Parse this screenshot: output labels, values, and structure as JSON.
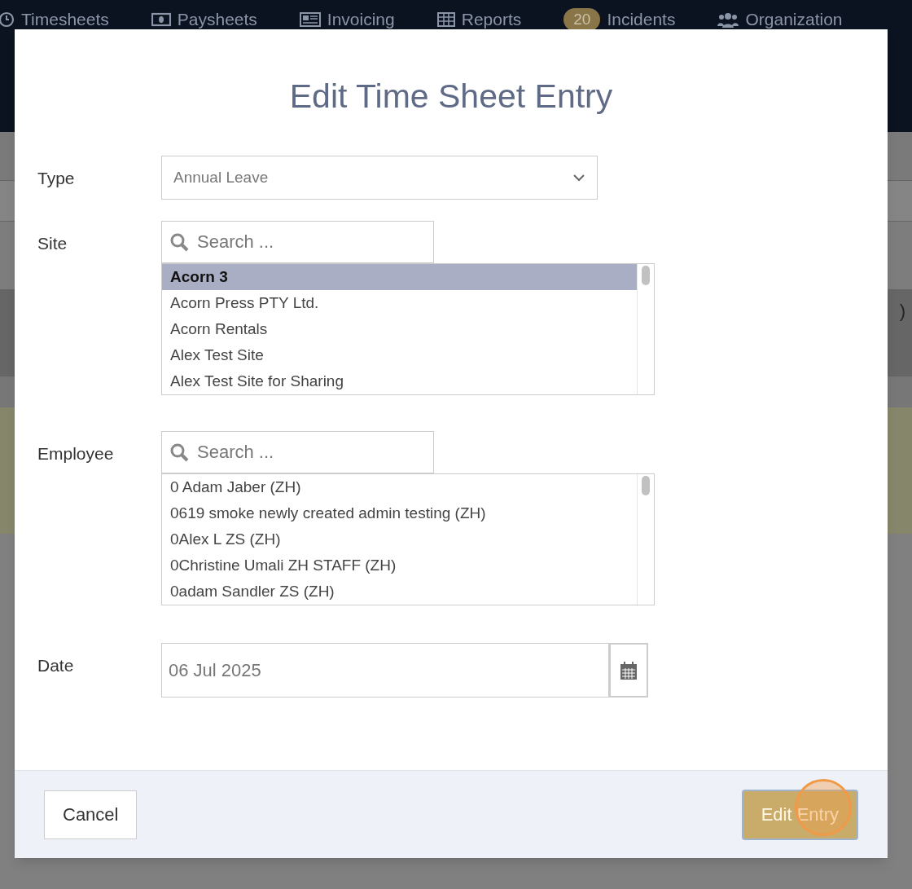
{
  "nav": [
    {
      "label": "Timesheets"
    },
    {
      "label": "Paysheets"
    },
    {
      "label": "Invoicing"
    },
    {
      "label": "Reports"
    },
    {
      "badge": "20",
      "label": "Incidents"
    },
    {
      "label": "Organization"
    }
  ],
  "background_fragment": ")",
  "dialog": {
    "title": "Edit Time Sheet Entry",
    "type": {
      "label": "Type",
      "value": "Annual Leave"
    },
    "site": {
      "label": "Site",
      "placeholder": "Search ...",
      "options": [
        {
          "label": "Acorn 3",
          "selected": true
        },
        {
          "label": "Acorn Press PTY Ltd.",
          "selected": false
        },
        {
          "label": "Acorn Rentals",
          "selected": false
        },
        {
          "label": "Alex Test Site",
          "selected": false
        },
        {
          "label": "Alex Test Site for Sharing",
          "selected": false
        }
      ]
    },
    "employee": {
      "label": "Employee",
      "placeholder": "Search ...",
      "options": [
        {
          "label": "0 Adam Jaber (ZH)",
          "selected": false
        },
        {
          "label": "0619 smoke newly created admin testing (ZH)",
          "selected": false
        },
        {
          "label": "0Alex L ZS (ZH)",
          "selected": false
        },
        {
          "label": "0Christine Umali ZH STAFF (ZH)",
          "selected": false
        },
        {
          "label": "0adam Sandler ZS (ZH)",
          "selected": false
        }
      ]
    },
    "date": {
      "label": "Date",
      "value": "06 Jul 2025"
    },
    "buttons": [
      {
        "kind": "secondary",
        "label": "Cancel"
      },
      {
        "kind": "primary",
        "label": "Edit Entry"
      }
    ]
  }
}
